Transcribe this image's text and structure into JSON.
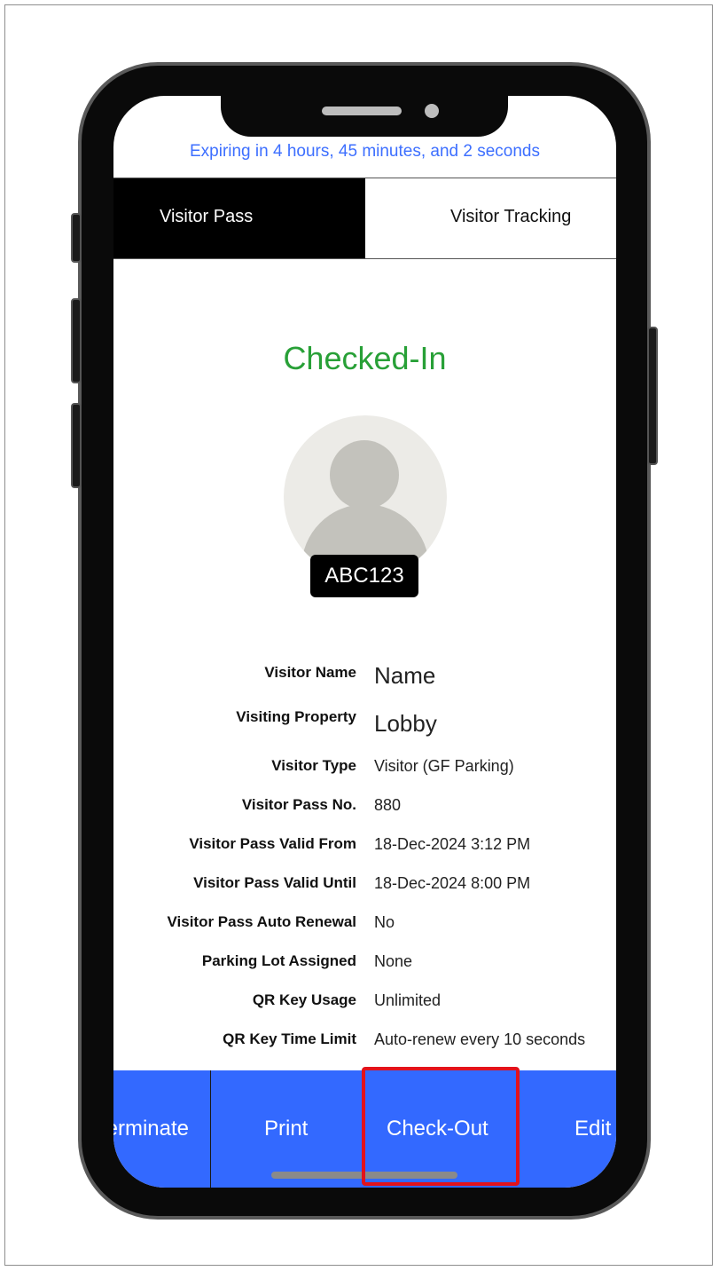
{
  "expiry_text": "Expiring in 4 hours, 45 minutes, and 2 seconds",
  "tabs": [
    {
      "label": "Visitor Pass",
      "active": true
    },
    {
      "label": "Visitor Tracking",
      "active": false
    }
  ],
  "status": {
    "label": "Checked-In",
    "color": "#28a037"
  },
  "visitor": {
    "code": "ABC123"
  },
  "details": [
    {
      "label": "Visitor Name",
      "value": "Name"
    },
    {
      "label": "Visiting Property",
      "value": "Lobby"
    },
    {
      "label": "Visitor Type",
      "value": "Visitor (GF Parking)"
    },
    {
      "label": "Visitor Pass No.",
      "value": "880"
    },
    {
      "label": "Visitor Pass Valid From",
      "value": "18-Dec-2024 3:12 PM"
    },
    {
      "label": "Visitor Pass Valid Until",
      "value": "18-Dec-2024 8:00 PM"
    },
    {
      "label": "Visitor Pass Auto Renewal",
      "value": "No"
    },
    {
      "label": "Parking Lot Assigned",
      "value": "None"
    },
    {
      "label": "QR Key Usage",
      "value": "Unlimited"
    },
    {
      "label": "QR Key Time Limit",
      "value": "Auto-renew every 10 seconds"
    }
  ],
  "actions": {
    "terminate": "Terminate",
    "print": "Print",
    "checkout": "Check-Out",
    "edit": "Edit"
  },
  "colors": {
    "accent": "#3369ff",
    "highlight": "#e3121b",
    "link": "#3d6fff"
  }
}
